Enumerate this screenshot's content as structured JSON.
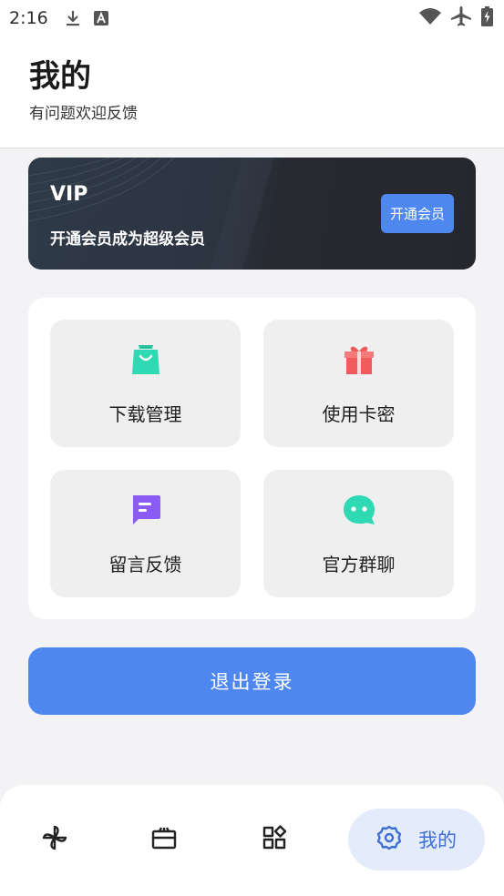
{
  "status_bar": {
    "time": "2:16",
    "icons": [
      "download-icon",
      "a-icon",
      "wifi-icon",
      "airplane-icon",
      "battery-icon"
    ]
  },
  "header": {
    "title": "我的",
    "subtitle": "有问题欢迎反馈"
  },
  "vip": {
    "title": "VIP",
    "description": "开通会员成为超级会员",
    "button_label": "开通会员",
    "accent": "#4f87f0"
  },
  "features": [
    {
      "label": "下载管理",
      "icon": "shopping-bag-icon",
      "color": "#2ed9b4"
    },
    {
      "label": "使用卡密",
      "icon": "gift-icon",
      "color": "#f25b5b"
    },
    {
      "label": "留言反馈",
      "icon": "message-icon",
      "color": "#8a5cf5"
    },
    {
      "label": "官方群聊",
      "icon": "chat-bubble-icon",
      "color": "#2ed9b4"
    }
  ],
  "logout": {
    "label": "退出登录"
  },
  "bottom_nav": {
    "items": [
      {
        "icon": "pinwheel-icon"
      },
      {
        "icon": "ticket-icon"
      },
      {
        "icon": "apps-icon"
      },
      {
        "icon": "gear-icon",
        "label": "我的",
        "active": true
      }
    ],
    "active_color": "#3f6ed8"
  }
}
